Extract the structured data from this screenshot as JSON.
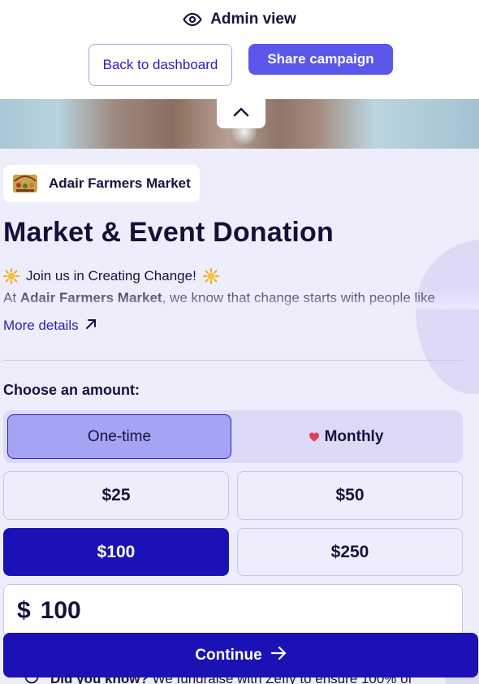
{
  "admin_bar": {
    "label": "Admin view",
    "back_button": "Back to dashboard",
    "share_button": "Share campaign"
  },
  "campaign": {
    "org_name": "Adair Farmers Market",
    "title": "Market & Event Donation",
    "intro_line": "Join us in Creating Change!",
    "body_prefix": "At ",
    "body_org": "Adair Farmers Market",
    "body_suffix": ", we know that change starts with people like",
    "more_details": "More details"
  },
  "donation": {
    "choose_label": "Choose an amount:",
    "frequency": {
      "one_time": "One-time",
      "monthly": "Monthly",
      "selected": "One-time"
    },
    "amounts": [
      "$25",
      "$50",
      "$100",
      "$250"
    ],
    "selected_amount": "$100",
    "currency_symbol": "$",
    "custom_value": "100"
  },
  "footer": {
    "did_you_know_bold": "Did you know?",
    "did_you_know_text": " We fundraise with Zeffy to ensure 100% of",
    "continue_label": "Continue"
  },
  "colors": {
    "brand_dark": "#1a12b5",
    "brand_accent": "#5b57eb",
    "lavender_bg": "#eeedfc",
    "heart": "#e83a4f"
  },
  "icons": {
    "eye": "eye-icon",
    "collapse": "chevron-up-icon",
    "external": "arrow-up-right-icon",
    "heart": "heart-icon",
    "sun": "sun-emoji-icon",
    "continue": "arrow-right-icon"
  }
}
